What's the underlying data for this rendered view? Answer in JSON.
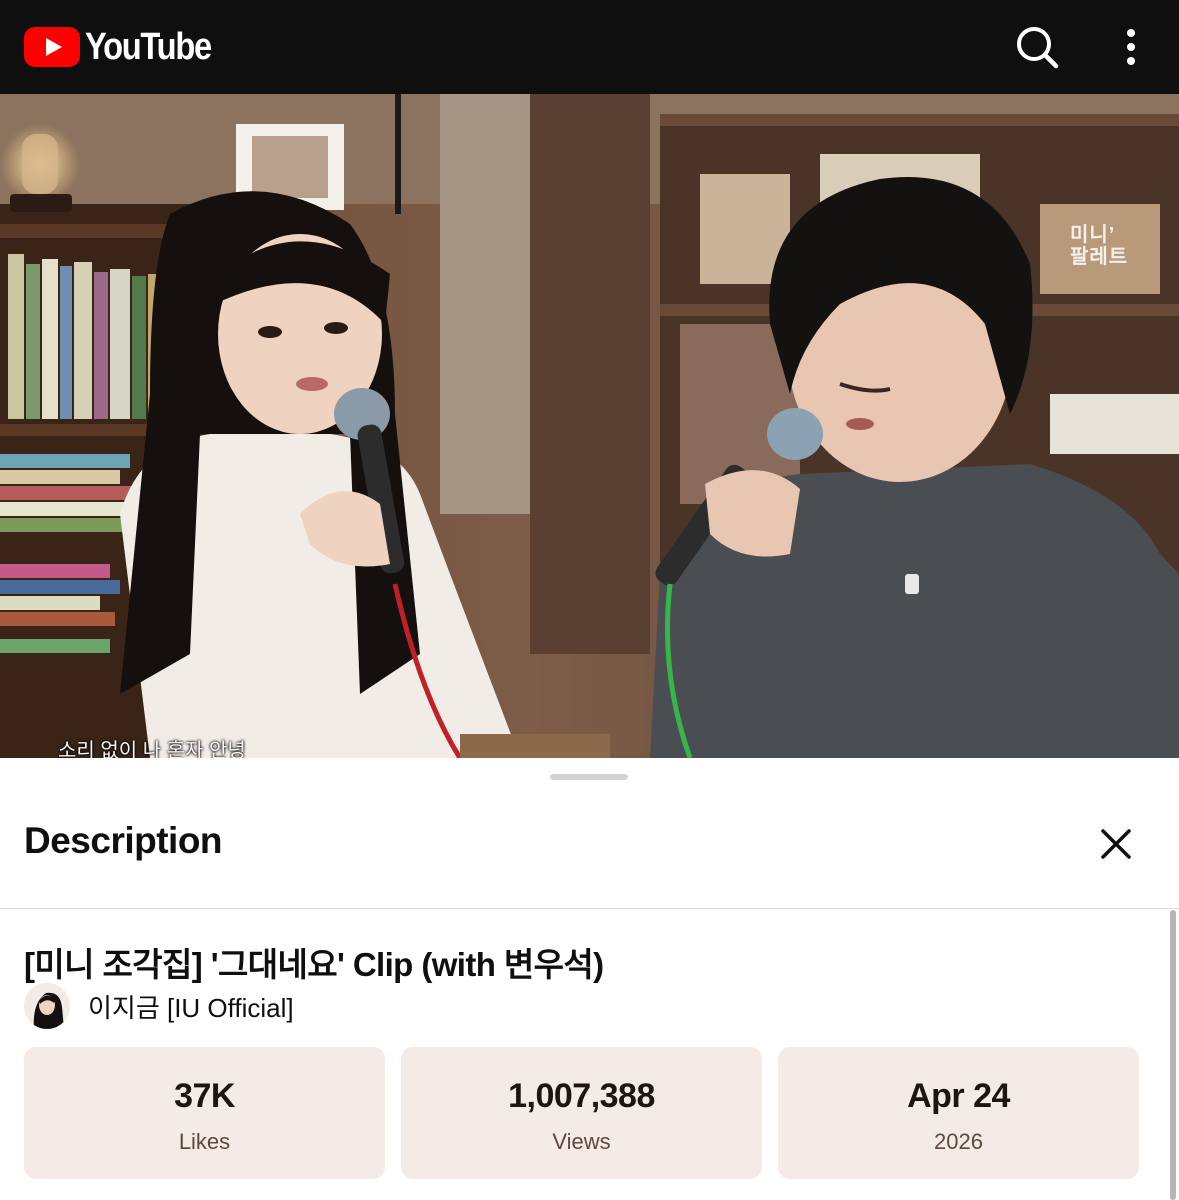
{
  "app": {
    "logo_text": "YouTube",
    "brand_color": "#ff0000",
    "topbar_icons": [
      "search-icon",
      "more-vert-icon"
    ]
  },
  "video": {
    "subtitle": "소리 없이 나 혼자 안녕",
    "watermark_line1": "미니’",
    "watermark_line2": "팔레트"
  },
  "description_sheet": {
    "header": "Description",
    "title": "[미니 조각집] '그대네요' Clip (with 변우석)",
    "channel_name": "이지금 [IU Official]",
    "stats": [
      {
        "value": "37K",
        "label": "Likes"
      },
      {
        "value": "1,007,388",
        "label": "Views"
      },
      {
        "value": "Apr 24",
        "label": "2026"
      }
    ]
  }
}
